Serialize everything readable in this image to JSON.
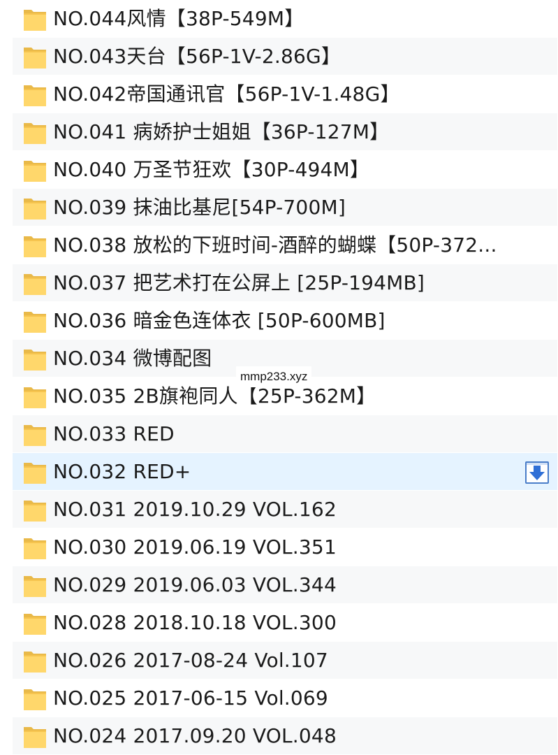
{
  "rows": [
    {
      "label": "NO.044风情【38P-549M】"
    },
    {
      "label": "NO.043天台【56P-1V-2.86G】"
    },
    {
      "label": "NO.042帝国通讯官【56P-1V-1.48G】"
    },
    {
      "label": "NO.041 病娇护士姐姐【36P-127M】"
    },
    {
      "label": "NO.040 万圣节狂欢【30P-494M】"
    },
    {
      "label": "NO.039 抹油比基尼[54P-700M]"
    },
    {
      "label": "NO.038 放松的下班时间-酒醉的蝴蝶【50P-372..."
    },
    {
      "label": "NO.037 把艺术打在公屏上 [25P-194MB]"
    },
    {
      "label": "NO.036 暗金色连体衣 [50P-600MB]"
    },
    {
      "label": "NO.034 微博配图"
    },
    {
      "label": "NO.035 2B旗袍同人【25P-362M】"
    },
    {
      "label": "NO.033 RED"
    },
    {
      "label": "NO.032 RED+"
    },
    {
      "label": "NO.031 2019.10.29 VOL.162"
    },
    {
      "label": "NO.030 2019.06.19 VOL.351"
    },
    {
      "label": "NO.029 2019.06.03 VOL.344"
    },
    {
      "label": "NO.028 2018.10.18 VOL.300"
    },
    {
      "label": "NO.026 2017-08-24 Vol.107"
    },
    {
      "label": "NO.025 2017-06-15 Vol.069"
    },
    {
      "label": "NO.024 2017.09.20 VOL.048"
    }
  ],
  "selected_row": "NO.032 RED+",
  "row_icon": "folder-icon",
  "download_icon": "download-arrow-icon",
  "watermark": "mmp233.xyz",
  "colors": {
    "folder_fill": "#ffd76b",
    "folder_edge": "#e3b23c",
    "selected_bg": "#e5f3ff",
    "alt_bg": "#f7f8f9",
    "download_arrow": "#2f6fd6"
  }
}
